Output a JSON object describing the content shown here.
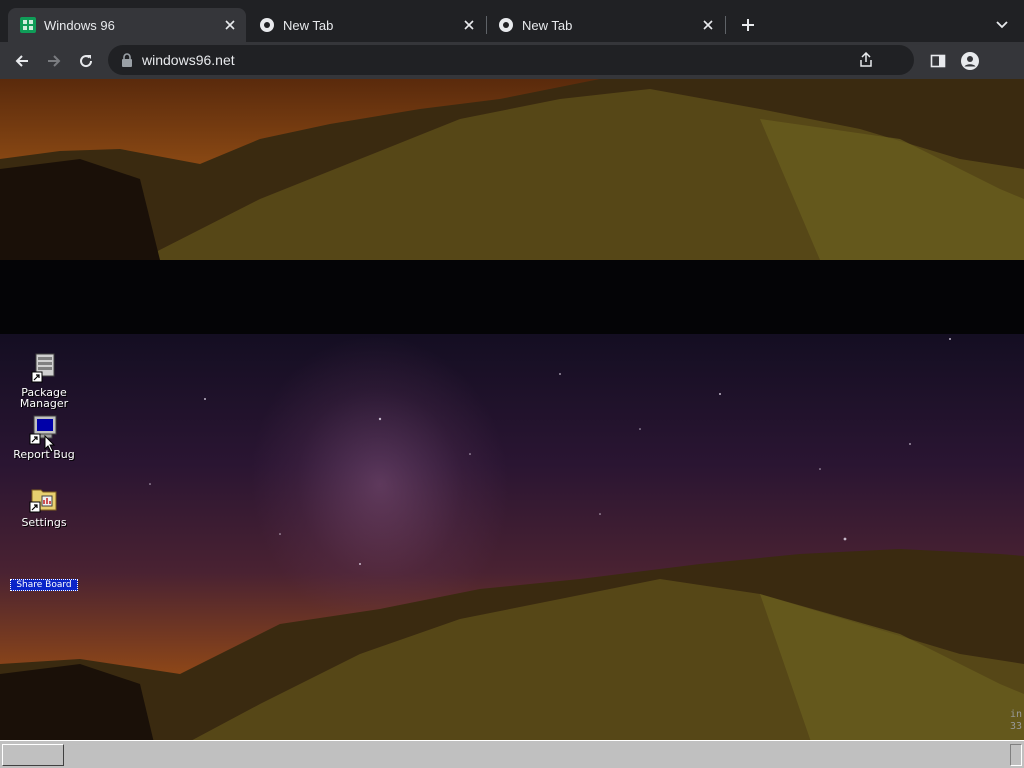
{
  "browser": {
    "tabs": [
      {
        "title": "Windows 96",
        "active": true
      },
      {
        "title": "New Tab",
        "active": false
      },
      {
        "title": "New Tab",
        "active": false
      }
    ],
    "url": "windows96.net"
  },
  "desktop": {
    "icons": [
      {
        "label_line1": "Package",
        "label_line2": "Manager",
        "icon": "package-manager-icon"
      },
      {
        "label_line1": "Report Bug",
        "icon": "report-bug-icon"
      },
      {
        "label_line1": "Settings",
        "icon": "settings-folder-icon"
      }
    ],
    "selected_icon_label": "Share Board",
    "corner_text_line1": "in",
    "corner_text_line2": "33"
  },
  "colors": {
    "chrome_bg": "#202124",
    "chrome_toolbar": "#35363a",
    "tab_accent_green": "#0f9d58",
    "taskbar": "#c0c0c0"
  }
}
